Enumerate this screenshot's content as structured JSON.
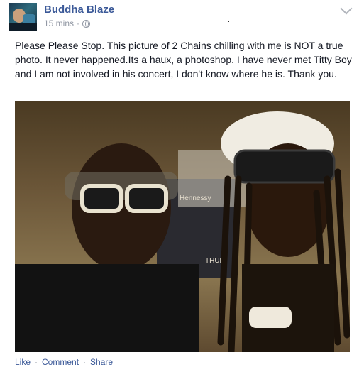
{
  "post": {
    "author": "Buddha Blaze",
    "time": "15 mins",
    "separator": "·",
    "text": "Please Please Stop. This picture of 2 Chains chilling with me is NOT a true photo. It never happened.Its a haux, a photoshop. I have never met Titty Boy and I am not involved in his concert, I don't know where he is. Thank you.",
    "photo_overlay": {
      "banner_line1": "Hennessy",
      "banner_line2": "THUR"
    }
  },
  "actions": {
    "like": "Like",
    "comment": "Comment",
    "share": "Share",
    "separator": "·"
  },
  "icons": {
    "privacy": "globe-icon",
    "menu": "chevron-down-icon"
  },
  "colors": {
    "author": "#3b5998",
    "meta": "#9197a3",
    "text": "#141823"
  }
}
